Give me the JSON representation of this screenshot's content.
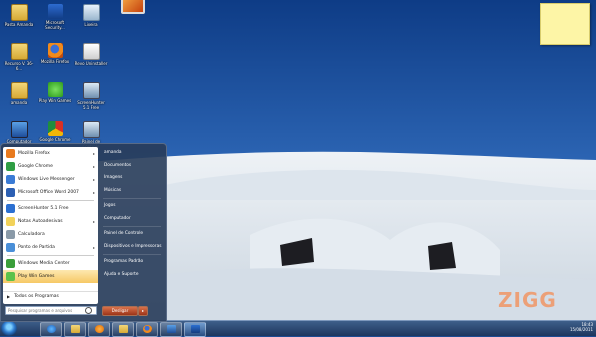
{
  "desktop": {
    "icons": [
      {
        "label": "Pasta Amanda",
        "icon": "folder-icon"
      },
      {
        "label": "Microsoft Security...",
        "icon": "security-essentials-icon"
      },
      {
        "label": "Lixeira",
        "icon": "recycle-bin-icon"
      },
      {
        "label": "Recurso V. 36-6...",
        "icon": "folder-icon"
      },
      {
        "label": "Mozilla Firefox",
        "icon": "firefox-icon"
      },
      {
        "label": "Revo Uninstaller",
        "icon": "revo-uninstaller-icon"
      },
      {
        "label": "amanda",
        "icon": "folder-icon"
      },
      {
        "label": "Play Win Games",
        "icon": "play-win-games-icon"
      },
      {
        "label": "ScreenHunter 5.1 Free",
        "icon": "screenhunter-icon"
      },
      {
        "label": "Computador",
        "icon": "computer-icon"
      },
      {
        "label": "Google Chrome",
        "icon": "chrome-icon"
      },
      {
        "label": "Painel de Controle",
        "icon": "control-panel-icon"
      }
    ]
  },
  "start_menu": {
    "programs": [
      {
        "label": "Mozilla Firefox",
        "arrow": "▸"
      },
      {
        "label": "Google Chrome",
        "arrow": "▸"
      },
      {
        "label": "Windows Live Messenger",
        "arrow": "▸"
      },
      {
        "label": "Microsoft Office Word 2007",
        "arrow": "▸"
      },
      {
        "label": "ScreenHunter 5.1 Free",
        "arrow": ""
      },
      {
        "label": "Notas Autoadesivas",
        "arrow": "▸"
      },
      {
        "label": "Calculadora",
        "arrow": ""
      },
      {
        "label": "Ponto de Partida",
        "arrow": "▸"
      },
      {
        "label": "Windows Media Center",
        "arrow": ""
      },
      {
        "label": "Play Win Games",
        "arrow": ""
      }
    ],
    "all_programs": "Todos os Programas",
    "all_programs_arrow": "▶",
    "search_placeholder": "Pesquisar programas e arquivos",
    "right_items": [
      "amanda",
      "Documentos",
      "Imagens",
      "Músicas",
      "Jogos",
      "Computador",
      "Painel de Controle",
      "Dispositivos e Impressoras",
      "Programas Padrão",
      "Ajuda e Suporte"
    ],
    "shutdown_label": "Desligar",
    "shutdown_arrow": "▸"
  },
  "taskbar": {
    "tray_time": "18:43",
    "tray_date": "15/08/2011"
  },
  "watermark": "ZIGG",
  "colors": {
    "sky": "#1b4b93",
    "highlight": "#f6c865",
    "taskbar": "#1d365d"
  }
}
